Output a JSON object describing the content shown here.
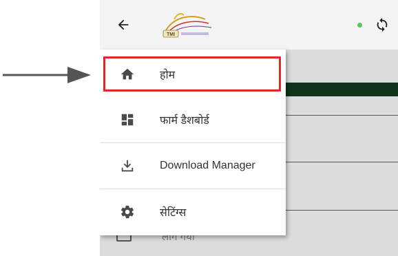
{
  "drawer": {
    "items": [
      {
        "label": "होम",
        "icon": "home-icon"
      },
      {
        "label": "फार्म डैशबोर्ड",
        "icon": "dashboard-icon"
      },
      {
        "label": "Download Manager",
        "icon": "download-icon"
      },
      {
        "label": "सेटिंग्स",
        "icon": "settings-icon"
      }
    ]
  },
  "header": {
    "logo_text": "TMI",
    "status_color": "#5cc85c"
  },
  "background": {
    "partial_text": "लाग गया"
  },
  "colors": {
    "highlight": "#e02a2a",
    "dark_band": "#10331c"
  }
}
